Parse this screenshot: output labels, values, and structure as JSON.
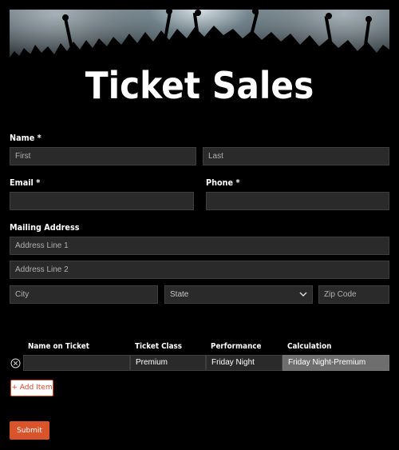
{
  "hero": {
    "title": "Ticket Sales"
  },
  "form": {
    "name": {
      "label": "Name *",
      "first_placeholder": "First",
      "last_placeholder": "Last"
    },
    "email": {
      "label": "Email *",
      "value": ""
    },
    "phone": {
      "label": "Phone *",
      "value": ""
    },
    "address": {
      "label": "Mailing Address",
      "line1_placeholder": "Address Line 1",
      "line2_placeholder": "Address Line 2",
      "city_placeholder": "City",
      "state_value": "State",
      "zip_placeholder": "Zip Code"
    }
  },
  "tickets": {
    "columns": [
      "Name on Ticket",
      "Ticket Class",
      "Performance",
      "Calculation"
    ],
    "rows": [
      {
        "name_on_ticket": "",
        "ticket_class": "Premium",
        "performance": "Friday Night",
        "calculation": "Friday Night-Premium"
      }
    ],
    "add_item_label": "+ Add Item"
  },
  "submit_label": "Submit",
  "colors": {
    "accent": "#d9532b",
    "field_bg": "#2a2a2a",
    "page_bg": "#000000"
  },
  "icons": {
    "remove_row": "remove-circle-icon",
    "state_dropdown": "chevron-down-icon"
  }
}
